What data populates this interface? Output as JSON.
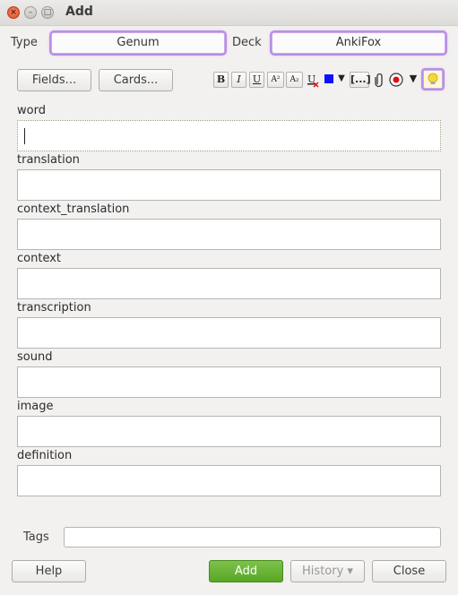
{
  "window": {
    "title": "Add"
  },
  "chooser": {
    "type_label": "Type",
    "type_value": "Genum",
    "deck_label": "Deck",
    "deck_value": "AnkiFox"
  },
  "toolbar": {
    "fields_label": "Fields...",
    "cards_label": "Cards...",
    "bold": "B",
    "italic": "I",
    "underline": "U",
    "superscript": "A²",
    "subscript": "A₂",
    "color_hex": "#1010ff",
    "cloze": "[...]"
  },
  "fields": [
    {
      "label": "word",
      "value": ""
    },
    {
      "label": "translation",
      "value": ""
    },
    {
      "label": "context_translation",
      "value": ""
    },
    {
      "label": "context",
      "value": ""
    },
    {
      "label": "transcription",
      "value": ""
    },
    {
      "label": "sound",
      "value": ""
    },
    {
      "label": "image",
      "value": ""
    },
    {
      "label": "definition",
      "value": ""
    }
  ],
  "tags": {
    "label": "Tags",
    "value": ""
  },
  "footer": {
    "help_label": "Help",
    "add_label": "Add",
    "history_label": "History ▾",
    "close_label": "Close"
  }
}
